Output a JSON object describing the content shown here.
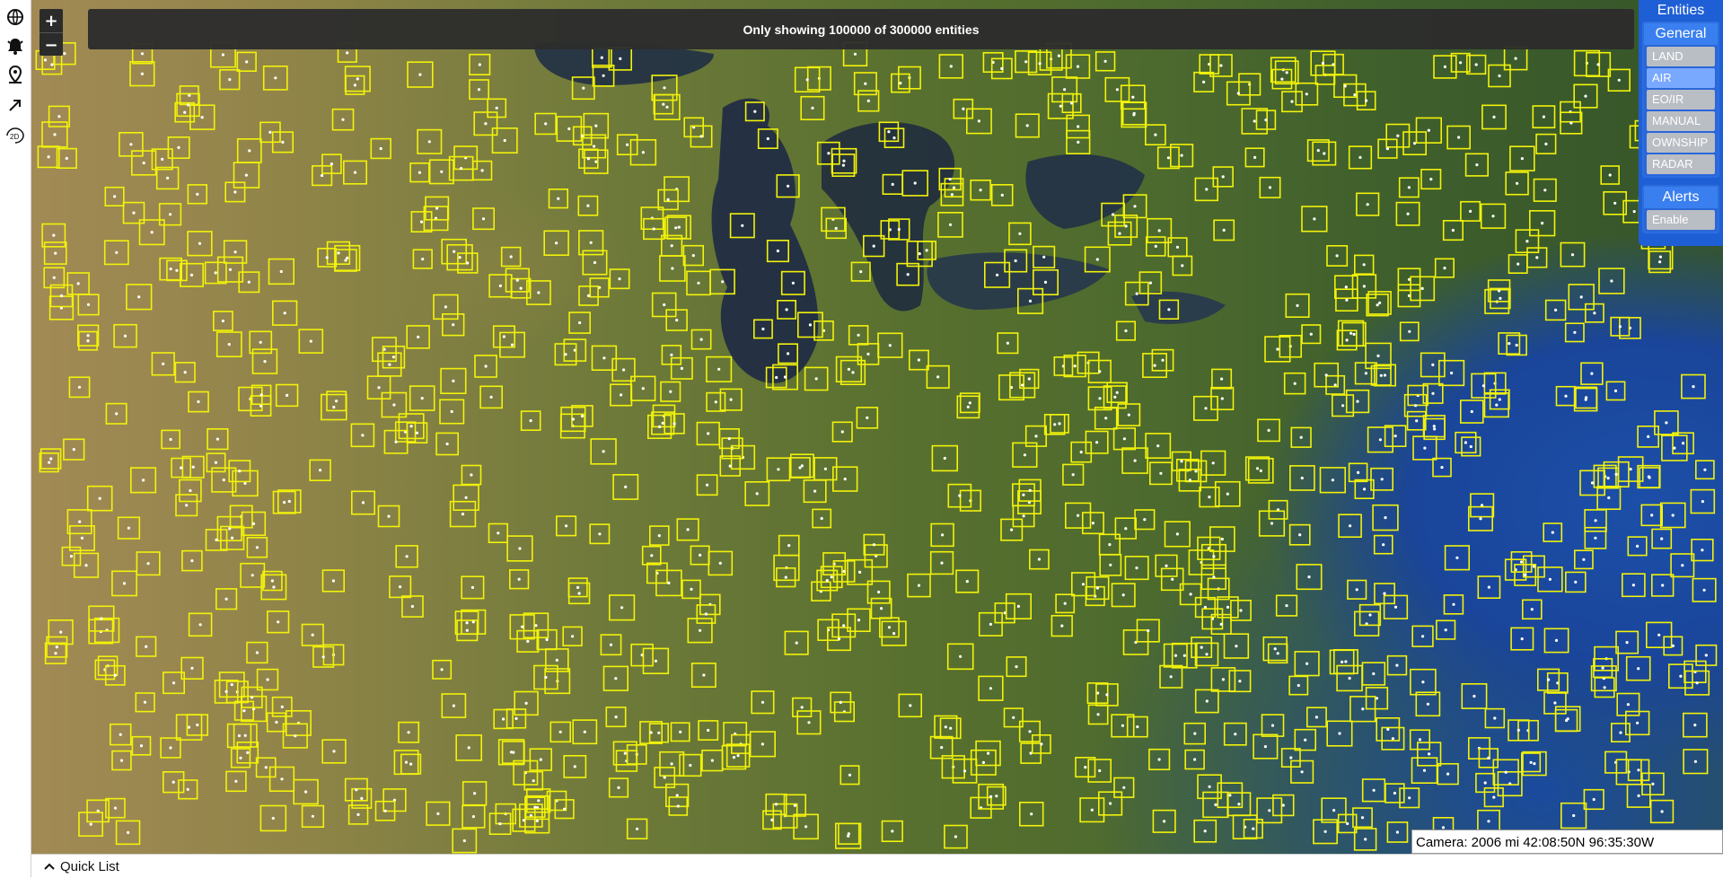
{
  "toolbar": {
    "items": [
      {
        "icon": "globe-icon"
      },
      {
        "icon": "bell-alert-icon"
      },
      {
        "icon": "map-pin-icon"
      },
      {
        "icon": "arrow-up-right-icon"
      },
      {
        "icon": "rotate-2d-icon",
        "label": "2D"
      }
    ]
  },
  "zoom": {
    "in_label": "+",
    "out_label": "−"
  },
  "banner": {
    "text": "Only showing 100000 of 300000 entities"
  },
  "entities_panel": {
    "title": "Entities",
    "general": {
      "heading": "General",
      "items": [
        {
          "label": "LAND",
          "active": false
        },
        {
          "label": "AIR",
          "active": true
        },
        {
          "label": "EO/IR",
          "active": false
        },
        {
          "label": "MANUAL",
          "active": false
        },
        {
          "label": "OWNSHIP",
          "active": false
        },
        {
          "label": "RADAR",
          "active": false
        }
      ]
    },
    "alerts": {
      "heading": "Alerts",
      "button_label": "Enable"
    }
  },
  "camera": {
    "text": "Camera: 2006 mi 42:08:50N 96:35:30W"
  },
  "quick_list": {
    "label": "Quick List"
  },
  "colors": {
    "track_box": "#f2f20a",
    "panel_blue": "#1f5fd6",
    "active_filter": "#79a8ff",
    "banner_bg": "#2d2d2d"
  },
  "map": {
    "track_count_shown": 100000,
    "track_count_total": 300000
  }
}
